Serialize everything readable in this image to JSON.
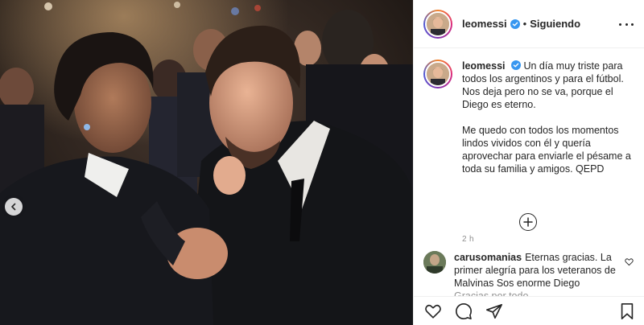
{
  "post": {
    "username": "leomessi",
    "separator": "•",
    "follow_status": "Siguiendo",
    "caption": "Un día muy triste para todos los argentinos y para el fútbol. Nos deja pero no se va, porque el Diego es eterno.\n\nMe quedo con todos los momentos lindos vividos con él y quería aprovechar para enviarle el pésame a toda su familia y amigos. QEPD",
    "time": "2 h"
  },
  "comments": [
    {
      "username": "carusomanias",
      "text": "Eternas gracias. La primer alegría para los veteranos de Malvinas",
      "extra": "Sos enorme Diego",
      "extra2": "Gracias por todo"
    }
  ],
  "icons": {
    "verified": "verified-badge-icon",
    "more": "more-options-icon",
    "prev": "chevron-left-icon",
    "load_more": "plus-circle-icon",
    "like": "heart-icon",
    "comment": "comment-icon",
    "share": "paper-plane-icon",
    "save": "bookmark-icon"
  },
  "colors": {
    "verified_blue": "#3897f0",
    "text": "#262626",
    "muted": "#8e8e8e",
    "border": "#efefef"
  }
}
